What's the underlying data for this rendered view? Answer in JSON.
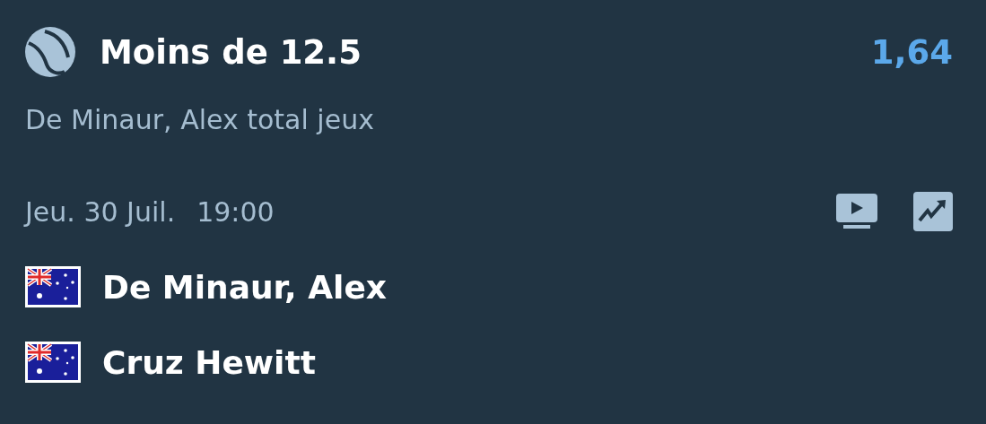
{
  "bet": {
    "selection": "Moins de 12.5",
    "odds": "1,64",
    "market": "De Minaur, Alex total jeux"
  },
  "event": {
    "date": "Jeu. 30 Juil.",
    "time": "19:00"
  },
  "players": [
    {
      "name": "De Minaur, Alex"
    },
    {
      "name": "Cruz Hewitt"
    }
  ]
}
